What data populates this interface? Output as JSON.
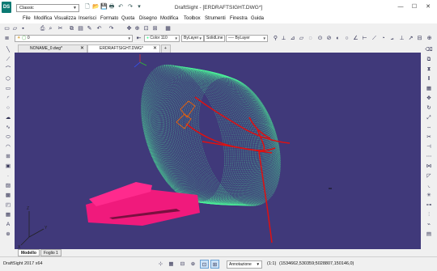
{
  "app": {
    "title": "DraftSight - [ERDRAFTSIGHT.DWG*]",
    "logo_text": "DS",
    "workspace": "Classic"
  },
  "window_controls": {
    "minimize": "—",
    "maximize": "☐",
    "close": "✕"
  },
  "menu": [
    "File",
    "Modifica",
    "Visualizza",
    "Inserisci",
    "Formato",
    "Quota",
    "Disegno",
    "Modifica",
    "Toolbox",
    "Strumenti",
    "Finestra",
    "Guida"
  ],
  "toolbar": {
    "layer": "0",
    "color": "Color 110",
    "linestyle": "ByLayer",
    "line_type": "SolidLine",
    "line_weight": "ByLayer"
  },
  "tabs": [
    {
      "label": "NONAME_0.dwg*",
      "active": false
    },
    {
      "label": "ERDRAFTSIGHT.DWG*",
      "active": true
    }
  ],
  "new_tab": "+",
  "layout_tabs": [
    "Modello",
    "Foglio 1"
  ],
  "status": {
    "app_version": "DraftSight 2017 x64",
    "annotation": "Annotazione",
    "scale": "(1:1)",
    "coordinates": "(1534662,530359;5028807,150146,0)"
  },
  "colors": {
    "canvas_bg": "#40397a",
    "mesh": "#4dfc9a",
    "profile": "#e01010",
    "block": "#f01a7c",
    "accent_orange": "#e06010"
  }
}
